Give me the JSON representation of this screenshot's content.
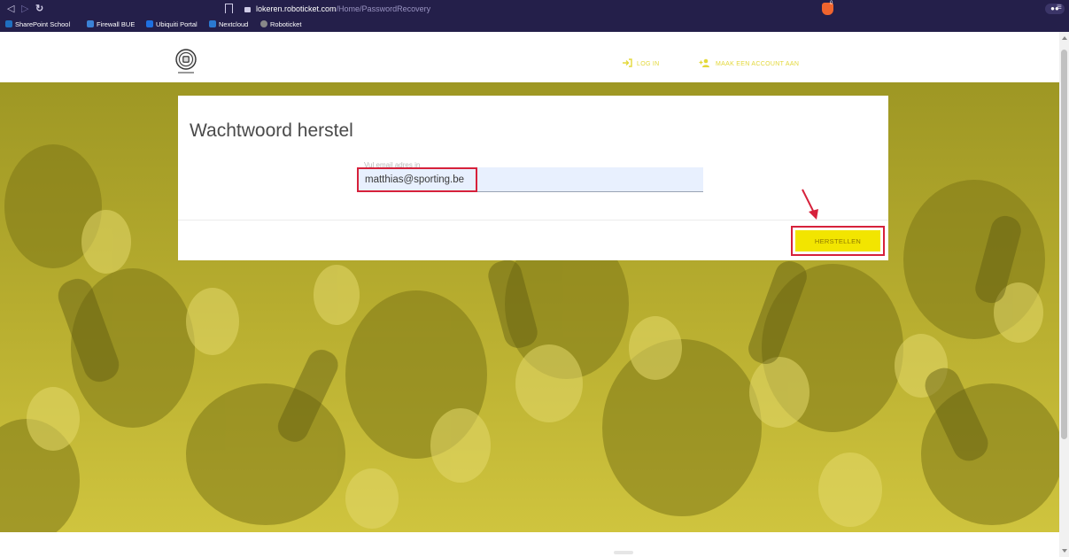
{
  "browser": {
    "url_domain": "lokeren.roboticket.com",
    "url_path": "/Home/PasswordRecovery",
    "brave_badge": "0",
    "bookmarks": [
      {
        "label": "SharePoint School",
        "color": "#1f6fbf"
      },
      {
        "label": "Firewall BUE",
        "color": "#3b82d6"
      },
      {
        "label": "Ubiquiti Portal",
        "color": "#1e6fe0"
      },
      {
        "label": "Nextcloud",
        "color": "#2b79d1"
      },
      {
        "label": "Roboticket",
        "color": "#888888"
      }
    ]
  },
  "header": {
    "login_label": "LOG IN",
    "register_label": "MAAK EEN ACCOUNT AAN",
    "accent_color": "#e3d83a"
  },
  "form": {
    "title": "Wachtwoord herstel",
    "email_label": "Vul email adres in",
    "email_value": "matthias@sporting.be",
    "submit_label": "HERSTELLEN"
  },
  "annotations": {
    "highlight_color": "#d6213b"
  },
  "icons": {
    "back": "back-icon",
    "forward": "forward-icon",
    "reload": "reload-icon",
    "login": "login-icon",
    "add_user": "add-user-icon"
  }
}
